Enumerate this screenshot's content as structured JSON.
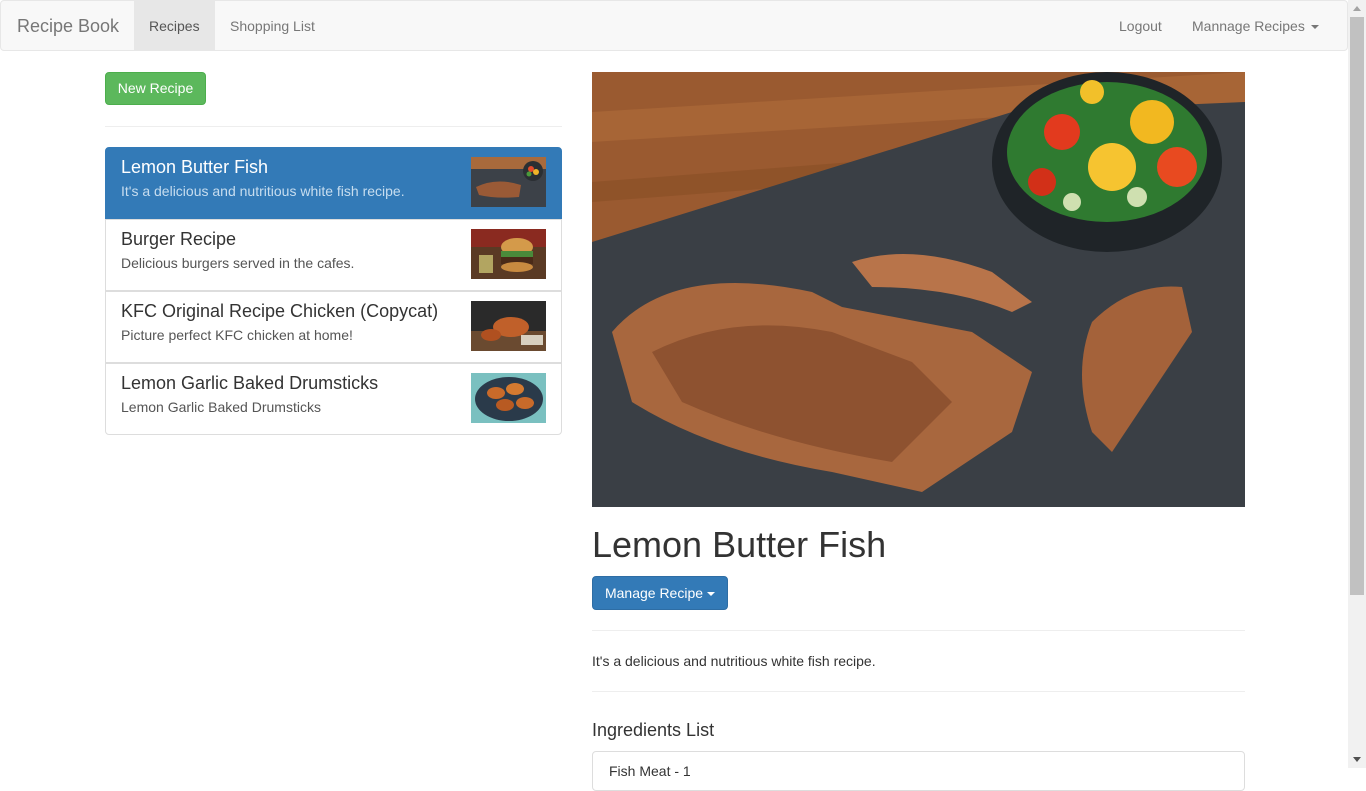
{
  "navbar": {
    "brand": "Recipe Book",
    "links": [
      "Recipes",
      "Shopping List"
    ],
    "active_link": "Recipes",
    "logout": "Logout",
    "manage_dropdown": "Mannage Recipes"
  },
  "sidebar": {
    "new_recipe_button": "New Recipe",
    "recipes": [
      {
        "name": "Lemon Butter Fish",
        "description": "It's a delicious and nutritious white fish recipe.",
        "active": true
      },
      {
        "name": "Burger Recipe",
        "description": "Delicious burgers served in the cafes.",
        "active": false
      },
      {
        "name": "KFC Original Recipe Chicken (Copycat)",
        "description": "Picture perfect KFC chicken at home!",
        "active": false
      },
      {
        "name": "Lemon Garlic Baked Drumsticks",
        "description": "Lemon Garlic Baked Drumsticks",
        "active": false
      }
    ]
  },
  "detail": {
    "title": "Lemon Butter Fish",
    "manage_button": "Manage Recipe",
    "description": "It's a delicious and nutritious white fish recipe.",
    "ingredients_heading": "Ingredients List",
    "ingredients": [
      "Fish Meat - 1"
    ]
  },
  "colors": {
    "navbar_bg": "#f8f8f8",
    "primary": "#337ab7",
    "success": "#5cb85c",
    "active_nav_bg": "#e7e7e7"
  },
  "icons": [
    "caret-down-icon",
    "caret-down-icon"
  ]
}
